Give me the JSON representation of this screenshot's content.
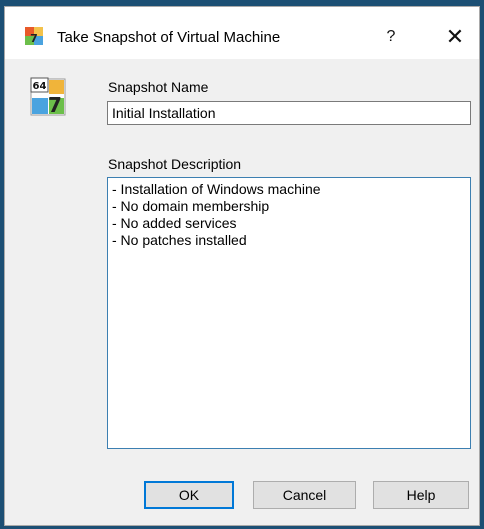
{
  "window": {
    "title": "Take Snapshot of Virtual Machine",
    "help_glyph": "?",
    "close_glyph": "✕"
  },
  "form": {
    "name_label": "Snapshot Name",
    "name_value": "Initial Installation",
    "description_label": "Snapshot Description",
    "description_lines": [
      "- Installation of Windows machine",
      "- No domain membership",
      "- No added services",
      "- No patches installed"
    ]
  },
  "buttons": {
    "ok": "OK",
    "cancel": "Cancel",
    "help": "Help"
  },
  "icon": {
    "badge_text": "64",
    "numeral": "7"
  },
  "colors": {
    "focus_border": "#3c7fb1",
    "default_button_border": "#0078d7"
  }
}
